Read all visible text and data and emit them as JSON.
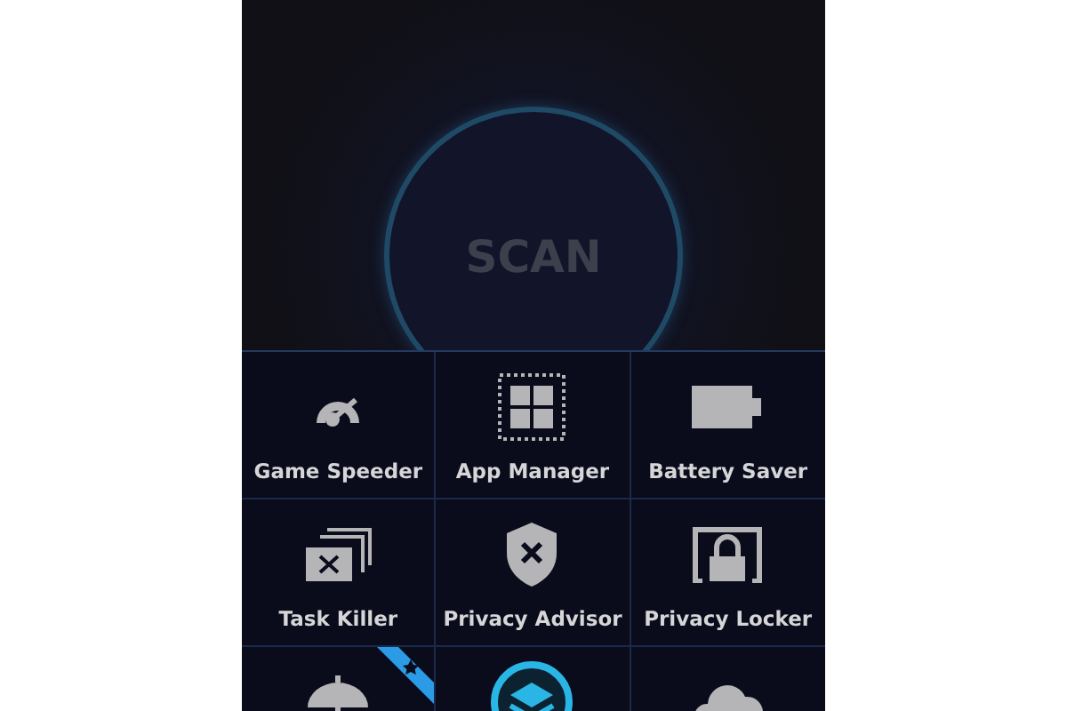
{
  "scan_button": {
    "label": "SCAN"
  },
  "tiles": [
    {
      "label": "Game Speeder",
      "badge": false
    },
    {
      "label": "App Manager",
      "badge": false
    },
    {
      "label": "Battery Saver",
      "badge": false
    },
    {
      "label": "Task Killer",
      "badge": false
    },
    {
      "label": "Privacy Advisor",
      "badge": false
    },
    {
      "label": "Privacy Locker",
      "badge": false
    },
    {
      "badge": true
    },
    {
      "badge": false
    },
    {
      "badge": false
    }
  ]
}
